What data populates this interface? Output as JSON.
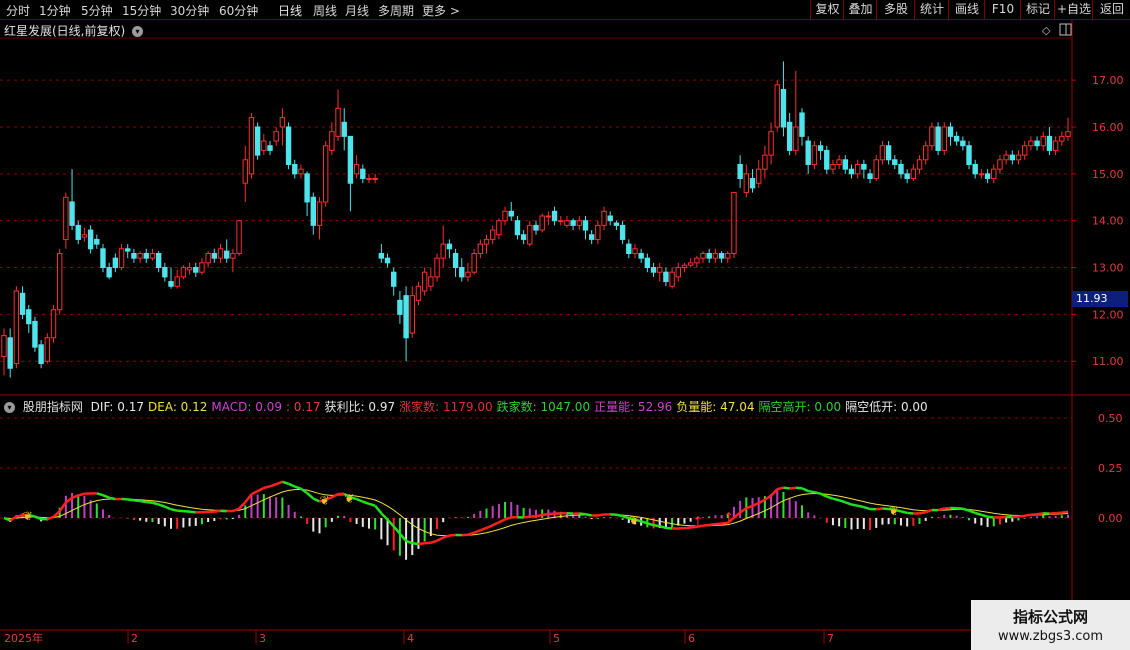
{
  "period_tabs": [
    "分时",
    "1分钟",
    "5分钟",
    "15分钟",
    "30分钟",
    "60分钟",
    "日线",
    "周线",
    "月线",
    "多周期",
    "更多 >"
  ],
  "toolbar": [
    "复权",
    "叠加",
    "多股",
    "统计",
    "画线",
    "F10",
    "标记",
    "+自选",
    "返回"
  ],
  "chart": {
    "title": "红星发展(日线,前复权)",
    "price_ticks": [
      "17.00",
      "16.00",
      "15.00",
      "14.00",
      "13.00",
      "12.00",
      "11.00"
    ],
    "current_price": "11.93",
    "price_range": [
      10.3,
      17.9
    ],
    "candles": [
      [
        11.1,
        11.55,
        10.7,
        11.7
      ],
      [
        11.5,
        10.85,
        10.65,
        11.7
      ],
      [
        10.95,
        12.5,
        10.85,
        12.6
      ],
      [
        12.45,
        12.0,
        11.9,
        12.6
      ],
      [
        12.1,
        11.8,
        11.6,
        12.2
      ],
      [
        11.85,
        11.3,
        11.2,
        11.95
      ],
      [
        11.35,
        10.95,
        10.85,
        11.45
      ],
      [
        11.0,
        11.5,
        10.95,
        11.6
      ],
      [
        11.5,
        12.1,
        11.4,
        12.2
      ],
      [
        12.1,
        13.3,
        12.0,
        13.4
      ],
      [
        13.6,
        14.5,
        13.4,
        14.6
      ],
      [
        14.4,
        13.9,
        13.8,
        15.1
      ],
      [
        13.9,
        13.6,
        13.5,
        14.0
      ],
      [
        13.65,
        13.7,
        13.55,
        13.85
      ],
      [
        13.8,
        13.4,
        13.3,
        13.9
      ],
      [
        13.6,
        13.5,
        13.4,
        13.7
      ],
      [
        13.4,
        13.0,
        12.9,
        13.5
      ],
      [
        13.0,
        12.8,
        12.75,
        13.1
      ],
      [
        13.2,
        13.0,
        12.9,
        13.3
      ],
      [
        13.0,
        13.4,
        12.95,
        13.5
      ],
      [
        13.4,
        13.35,
        13.2,
        13.5
      ],
      [
        13.3,
        13.2,
        13.1,
        13.4
      ],
      [
        13.2,
        13.3,
        13.1,
        13.35
      ],
      [
        13.3,
        13.2,
        13.1,
        13.4
      ],
      [
        13.2,
        13.3,
        13.15,
        13.4
      ],
      [
        13.3,
        13.0,
        12.9,
        13.35
      ],
      [
        13.0,
        12.8,
        12.7,
        13.1
      ],
      [
        12.7,
        12.6,
        12.55,
        13.0
      ],
      [
        12.6,
        12.8,
        12.55,
        12.95
      ],
      [
        12.8,
        13.0,
        12.75,
        13.05
      ],
      [
        12.95,
        13.0,
        12.85,
        13.1
      ],
      [
        13.0,
        12.9,
        12.8,
        13.1
      ],
      [
        12.9,
        13.1,
        12.85,
        13.2
      ],
      [
        13.1,
        13.3,
        13.0,
        13.35
      ],
      [
        13.3,
        13.2,
        13.1,
        13.4
      ],
      [
        13.2,
        13.4,
        13.1,
        13.5
      ],
      [
        13.35,
        13.2,
        13.1,
        13.6
      ],
      [
        13.2,
        13.3,
        12.9,
        13.4
      ],
      [
        13.3,
        14.0,
        13.25,
        14.0
      ],
      [
        14.8,
        15.3,
        14.4,
        15.6
      ],
      [
        15.0,
        16.2,
        14.9,
        16.3
      ],
      [
        16.0,
        15.4,
        15.3,
        16.1
      ],
      [
        15.5,
        15.7,
        15.4,
        15.85
      ],
      [
        15.6,
        15.5,
        15.4,
        15.7
      ],
      [
        15.7,
        15.9,
        15.6,
        16.0
      ],
      [
        16.0,
        16.2,
        15.6,
        16.4
      ],
      [
        16.0,
        15.2,
        15.1,
        16.1
      ],
      [
        15.2,
        15.0,
        14.9,
        15.3
      ],
      [
        15.0,
        15.1,
        14.9,
        15.2
      ],
      [
        15.0,
        14.4,
        14.1,
        15.05
      ],
      [
        14.5,
        13.9,
        13.7,
        14.6
      ],
      [
        13.9,
        14.4,
        13.6,
        14.5
      ],
      [
        14.4,
        15.6,
        14.3,
        15.7
      ],
      [
        15.5,
        15.9,
        15.4,
        16.1
      ],
      [
        15.8,
        16.4,
        15.7,
        16.8
      ],
      [
        16.1,
        15.8,
        15.5,
        16.4
      ],
      [
        15.8,
        14.8,
        14.2,
        15.4
      ],
      [
        15.0,
        15.2,
        14.9,
        15.4
      ],
      [
        15.1,
        14.9,
        14.8,
        15.2
      ],
      [
        14.9,
        14.9,
        14.8,
        15.0
      ],
      [
        14.9,
        14.9,
        14.8,
        15.0
      ],
      [
        13.3,
        13.2,
        13.1,
        13.5
      ],
      [
        13.2,
        13.1,
        13.0,
        13.3
      ],
      [
        12.9,
        12.6,
        12.4,
        13.0
      ],
      [
        12.3,
        12.0,
        11.8,
        12.5
      ],
      [
        12.4,
        11.5,
        11.0,
        12.6
      ],
      [
        11.6,
        12.4,
        11.5,
        12.6
      ],
      [
        12.3,
        12.6,
        12.2,
        12.7
      ],
      [
        12.5,
        12.9,
        12.4,
        13.0
      ],
      [
        12.6,
        12.8,
        12.5,
        13.0
      ],
      [
        12.8,
        13.2,
        12.7,
        13.3
      ],
      [
        13.2,
        13.5,
        13.0,
        13.9
      ],
      [
        13.5,
        13.4,
        13.2,
        13.6
      ],
      [
        13.3,
        13.0,
        12.8,
        13.4
      ],
      [
        13.0,
        12.8,
        12.7,
        13.2
      ],
      [
        12.8,
        12.9,
        12.7,
        13.1
      ],
      [
        12.9,
        13.3,
        12.85,
        13.4
      ],
      [
        13.3,
        13.5,
        13.2,
        13.6
      ],
      [
        13.5,
        13.6,
        13.3,
        13.7
      ],
      [
        13.6,
        13.8,
        13.5,
        13.9
      ],
      [
        13.7,
        14.0,
        13.6,
        14.05
      ],
      [
        14.0,
        14.2,
        13.9,
        14.3
      ],
      [
        14.2,
        14.1,
        14.0,
        14.4
      ],
      [
        14.0,
        13.7,
        13.6,
        14.1
      ],
      [
        13.7,
        13.6,
        13.5,
        13.8
      ],
      [
        13.5,
        13.9,
        13.45,
        14.0
      ],
      [
        13.9,
        13.8,
        13.7,
        14.0
      ],
      [
        13.8,
        14.1,
        13.75,
        14.15
      ],
      [
        14.1,
        14.1,
        13.9,
        14.2
      ],
      [
        14.2,
        14.0,
        13.9,
        14.3
      ],
      [
        14.0,
        14.0,
        13.9,
        14.1
      ],
      [
        13.9,
        14.0,
        13.85,
        14.1
      ],
      [
        14.0,
        13.9,
        13.8,
        14.05
      ],
      [
        13.9,
        14.0,
        13.8,
        14.1
      ],
      [
        14.0,
        13.8,
        13.6,
        14.1
      ],
      [
        13.7,
        13.6,
        13.5,
        13.8
      ],
      [
        13.6,
        13.9,
        13.5,
        14.0
      ],
      [
        13.9,
        14.2,
        13.8,
        14.3
      ],
      [
        14.1,
        14.0,
        13.9,
        14.2
      ],
      [
        13.95,
        13.9,
        13.8,
        14.0
      ],
      [
        13.9,
        13.6,
        13.5,
        14.0
      ],
      [
        13.5,
        13.3,
        13.2,
        13.6
      ],
      [
        13.3,
        13.4,
        13.2,
        13.5
      ],
      [
        13.3,
        13.2,
        13.1,
        13.4
      ],
      [
        13.2,
        13.0,
        12.9,
        13.3
      ],
      [
        13.0,
        12.9,
        12.8,
        13.1
      ],
      [
        12.9,
        13.0,
        12.7,
        13.1
      ],
      [
        12.9,
        12.7,
        12.6,
        13.0
      ],
      [
        12.6,
        12.9,
        12.55,
        13.0
      ],
      [
        12.8,
        13.0,
        12.7,
        13.1
      ],
      [
        13.0,
        13.05,
        12.9,
        13.1
      ],
      [
        13.05,
        13.1,
        13.0,
        13.2
      ],
      [
        13.1,
        13.2,
        13.0,
        13.25
      ],
      [
        13.2,
        13.3,
        13.1,
        13.35
      ],
      [
        13.3,
        13.2,
        13.1,
        13.4
      ],
      [
        13.2,
        13.3,
        13.1,
        13.4
      ],
      [
        13.3,
        13.2,
        13.1,
        13.35
      ],
      [
        13.2,
        13.3,
        13.1,
        13.35
      ],
      [
        13.3,
        14.6,
        13.2,
        14.6
      ],
      [
        15.2,
        14.9,
        14.7,
        15.4
      ],
      [
        14.6,
        15.0,
        14.5,
        15.2
      ],
      [
        14.9,
        14.7,
        14.6,
        15.1
      ],
      [
        14.8,
        15.1,
        14.7,
        15.3
      ],
      [
        15.1,
        15.4,
        14.9,
        15.6
      ],
      [
        15.4,
        15.9,
        15.2,
        16.1
      ],
      [
        16.0,
        16.9,
        15.9,
        17.0
      ],
      [
        16.8,
        16.0,
        15.8,
        17.4
      ],
      [
        16.1,
        15.5,
        15.4,
        16.3
      ],
      [
        15.5,
        16.0,
        15.4,
        17.2
      ],
      [
        16.3,
        15.8,
        15.6,
        16.4
      ],
      [
        15.7,
        15.2,
        15.0,
        15.8
      ],
      [
        15.2,
        15.6,
        15.1,
        15.7
      ],
      [
        15.6,
        15.5,
        15.3,
        15.7
      ],
      [
        15.5,
        15.1,
        15.0,
        15.6
      ],
      [
        15.1,
        15.2,
        15.0,
        15.3
      ],
      [
        15.2,
        15.3,
        15.1,
        15.4
      ],
      [
        15.3,
        15.1,
        15.0,
        15.4
      ],
      [
        15.1,
        15.0,
        14.9,
        15.2
      ],
      [
        15.0,
        15.2,
        14.9,
        15.3
      ],
      [
        15.2,
        15.1,
        14.9,
        15.3
      ],
      [
        15.0,
        14.9,
        14.8,
        15.1
      ],
      [
        14.9,
        15.3,
        14.85,
        15.4
      ],
      [
        15.3,
        15.6,
        15.2,
        15.7
      ],
      [
        15.6,
        15.3,
        15.2,
        15.7
      ],
      [
        15.3,
        15.2,
        15.1,
        15.4
      ],
      [
        15.2,
        15.0,
        14.9,
        15.3
      ],
      [
        15.0,
        14.9,
        14.8,
        15.1
      ],
      [
        14.9,
        15.1,
        14.85,
        15.2
      ],
      [
        15.1,
        15.3,
        15.0,
        15.4
      ],
      [
        15.3,
        15.6,
        15.2,
        15.7
      ],
      [
        15.6,
        16.0,
        15.5,
        16.1
      ],
      [
        16.0,
        15.5,
        15.4,
        16.1
      ],
      [
        15.5,
        16.0,
        15.4,
        16.1
      ],
      [
        16.0,
        15.8,
        15.6,
        16.1
      ],
      [
        15.8,
        15.7,
        15.6,
        15.9
      ],
      [
        15.7,
        15.6,
        15.5,
        15.8
      ],
      [
        15.6,
        15.2,
        15.1,
        15.7
      ],
      [
        15.2,
        15.0,
        14.9,
        15.3
      ],
      [
        15.0,
        15.0,
        14.9,
        15.1
      ],
      [
        15.0,
        14.9,
        14.8,
        15.1
      ],
      [
        14.9,
        15.1,
        14.8,
        15.2
      ],
      [
        15.1,
        15.3,
        15.0,
        15.4
      ],
      [
        15.3,
        15.4,
        15.2,
        15.5
      ],
      [
        15.4,
        15.3,
        15.2,
        15.5
      ],
      [
        15.3,
        15.4,
        15.2,
        15.5
      ],
      [
        15.4,
        15.6,
        15.3,
        15.7
      ],
      [
        15.6,
        15.7,
        15.5,
        15.8
      ],
      [
        15.7,
        15.6,
        15.5,
        15.8
      ],
      [
        15.6,
        15.8,
        15.5,
        15.9
      ],
      [
        15.8,
        15.5,
        15.4,
        16.0
      ],
      [
        15.5,
        15.7,
        15.4,
        15.8
      ],
      [
        15.7,
        15.8,
        15.6,
        15.9
      ],
      [
        15.8,
        15.9,
        15.7,
        16.2
      ]
    ]
  },
  "indicator": {
    "name": "股朋指标网",
    "fields": [
      {
        "label": "DIF:",
        "value": "0.17",
        "color": "#e8e8e8"
      },
      {
        "label": "DEA:",
        "value": "0.12",
        "color": "#f0e040"
      },
      {
        "label": "MACD:",
        "value": "0.09",
        "color": "#d040d0"
      },
      {
        "label": ":",
        "value": "0.17",
        "color": "#e04040"
      },
      {
        "label": "获利比:",
        "value": "0.97",
        "color": "#e8e8e8"
      },
      {
        "label": "涨家数:",
        "value": "1179.00",
        "color": "#e03030"
      },
      {
        "label": "跌家数:",
        "value": "1047.00",
        "color": "#30d030"
      },
      {
        "label": "正量能:",
        "value": "52.96",
        "color": "#d040d0"
      },
      {
        "label": "负量能:",
        "value": "47.04",
        "color": "#f0e040"
      },
      {
        "label": "隔空高开:",
        "value": "0.00",
        "color": "#30d030"
      },
      {
        "label": "隔空低开:",
        "value": "0.00",
        "color": "#e8e8e8"
      }
    ],
    "ticks": [
      "0.50",
      "0.25",
      "0.00"
    ],
    "range": [
      -0.55,
      0.53
    ]
  },
  "date_axis": {
    "year": "2025年",
    "months": [
      "2",
      "3",
      "4",
      "5",
      "6",
      "7"
    ]
  },
  "watermark": {
    "line1": "指标公式网",
    "line2": "www.zbgs3.com"
  },
  "icons": [
    "chevron-down-icon",
    "diamond-icon",
    "panel-toggle-icon",
    "butterfly-icon",
    "arrow-up-icon"
  ],
  "colors": {
    "up": "#ff2d2d",
    "down": "#4fe4ec",
    "dif": "#ffffff",
    "dea": "#f0e040",
    "grid": "#8a0000"
  }
}
